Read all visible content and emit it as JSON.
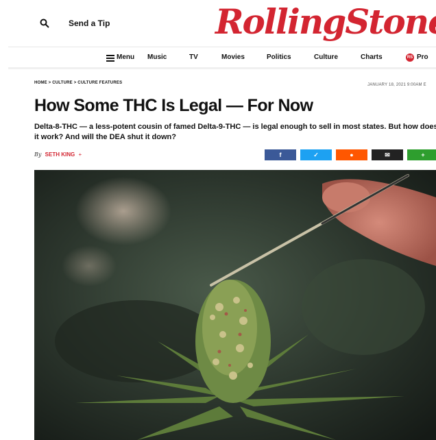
{
  "header": {
    "search_icon": "search-icon",
    "send_tip": "Send a Tip",
    "logo": "RollingStone"
  },
  "nav": {
    "items": [
      "Menu",
      "Music",
      "TV",
      "Movies",
      "Politics",
      "Culture",
      "Charts",
      "Pro"
    ]
  },
  "article": {
    "breadcrumb": "HOME > CULTURE > CULTURE FEATURES",
    "date": "JANUARY 18, 2021 9:00AM E",
    "title": "How Some THC Is Legal — For Now",
    "dek": "Delta-8-THC — a less-potent cousin of famed Delta-9-THC — is legal enough to sell in most states. But how does it work? And will the DEA shut it down?",
    "by": "By",
    "author": "SETH KING",
    "author_follow": "+"
  },
  "share": {
    "buttons": [
      {
        "label": "f",
        "color": "#3b5998"
      },
      {
        "label": "✓",
        "color": "#1da1f2"
      },
      {
        "label": "●",
        "color": "#ff5700"
      },
      {
        "label": "✉",
        "color": "#222222"
      },
      {
        "label": "+",
        "color": "#2e9e2e"
      }
    ]
  },
  "colors": {
    "brand": "#d32531"
  }
}
